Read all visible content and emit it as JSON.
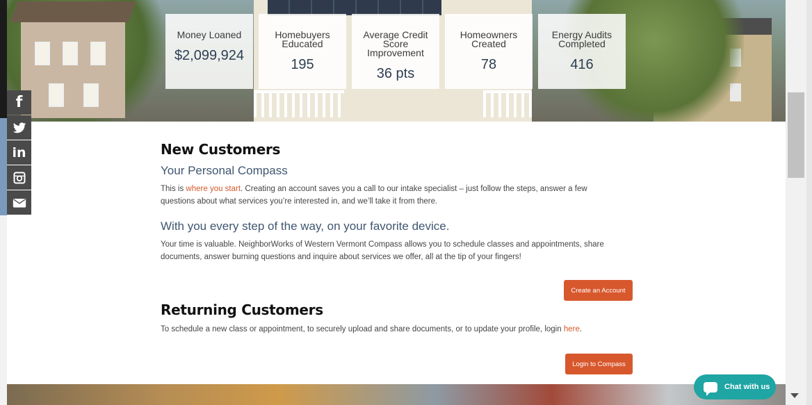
{
  "stats": [
    {
      "label": "Money Loaned",
      "value": "$2,099,924"
    },
    {
      "label": "Homebuyers Educated",
      "value": "195"
    },
    {
      "label": "Average Credit Score Improvement",
      "value": "36 pts"
    },
    {
      "label": "Homeowners Created",
      "value": "78"
    },
    {
      "label": "Energy Audits Completed",
      "value": "416"
    }
  ],
  "social": {
    "facebook": "f",
    "linkedin": "in"
  },
  "new_customers": {
    "heading": "New Customers",
    "subheading": "Your Personal Compass",
    "para1_prefix": "This is ",
    "para1_link": "where you start",
    "para1_suffix": ". Creating an account saves you a call to our intake specialist – just follow the steps, answer a few questions about what services you’re interested in, and we’ll take it from there.",
    "subheading2": "With you every step of the way, on your favorite device.",
    "para2": "Your time is valuable. NeighborWorks of Western Vermont Compass allows you to schedule classes and appointments, share documents, answer burning questions and inquire about services we offer, all at the tip of your fingers!",
    "button": "Create an Account"
  },
  "returning_customers": {
    "heading": "Returning Customers",
    "para_prefix": "To schedule a new class or appointment, to securely upload and share documents, or to update your profile, login ",
    "para_link": "here",
    "para_suffix": ".",
    "button": "Login to Compass"
  },
  "chat": {
    "label": "Chat with us"
  },
  "colors": {
    "accent": "#d8582d",
    "chat": "#1fa5a3",
    "heading_blue": "#3f5670"
  }
}
